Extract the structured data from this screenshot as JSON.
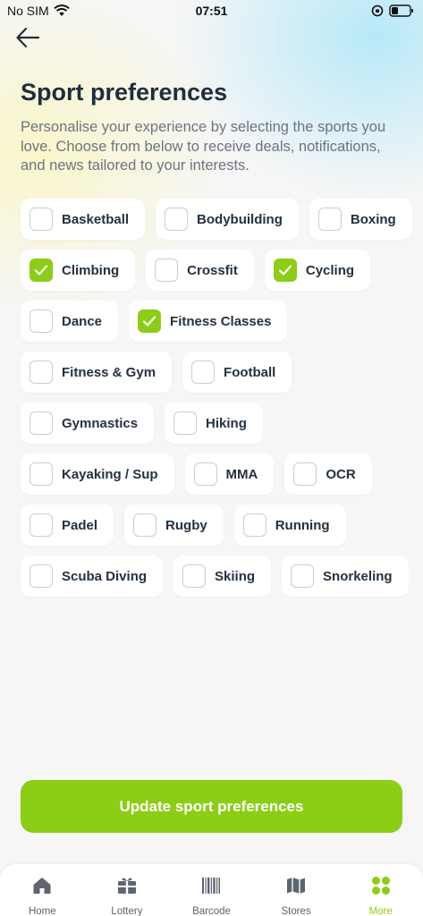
{
  "status_bar": {
    "carrier": "No SIM",
    "time": "07:51"
  },
  "header": {
    "title": "Sport preferences",
    "description": "Personalise your experience by selecting the sports you love. Choose from below to receive deals, notifications, and news tailored to your interests."
  },
  "sports": {
    "rows": [
      [
        {
          "label": "Basketball",
          "checked": false
        },
        {
          "label": "Bodybuilding",
          "checked": false
        },
        {
          "label": "Boxing",
          "checked": false
        }
      ],
      [
        {
          "label": "Climbing",
          "checked": true
        },
        {
          "label": "Crossfit",
          "checked": false
        },
        {
          "label": "Cycling",
          "checked": true
        }
      ],
      [
        {
          "label": "Dance",
          "checked": false
        },
        {
          "label": "Fitness Classes",
          "checked": true
        }
      ],
      [
        {
          "label": "Fitness & Gym",
          "checked": false
        },
        {
          "label": "Football",
          "checked": false
        }
      ],
      [
        {
          "label": "Gymnastics",
          "checked": false
        },
        {
          "label": "Hiking",
          "checked": false
        }
      ],
      [
        {
          "label": "Kayaking / Sup",
          "checked": false
        },
        {
          "label": "MMA",
          "checked": false
        },
        {
          "label": "OCR",
          "checked": false
        }
      ],
      [
        {
          "label": "Padel",
          "checked": false
        },
        {
          "label": "Rugby",
          "checked": false
        },
        {
          "label": "Running",
          "checked": false
        }
      ],
      [
        {
          "label": "Scuba Diving",
          "checked": false
        },
        {
          "label": "Skiing",
          "checked": false
        },
        {
          "label": "Snorkeling",
          "checked": false
        }
      ]
    ]
  },
  "cta": {
    "label": "Update sport preferences"
  },
  "tabbar": {
    "items": [
      {
        "label": "Home",
        "icon": "home-icon",
        "active": false
      },
      {
        "label": "Lottery",
        "icon": "gift-icon",
        "active": false
      },
      {
        "label": "Barcode",
        "icon": "barcode-icon",
        "active": false
      },
      {
        "label": "Stores",
        "icon": "map-icon",
        "active": false
      },
      {
        "label": "More",
        "icon": "grid-icon",
        "active": true
      }
    ]
  },
  "colors": {
    "accent": "#8ccd16",
    "text": "#1f2e3d",
    "muted": "#6c7480"
  }
}
